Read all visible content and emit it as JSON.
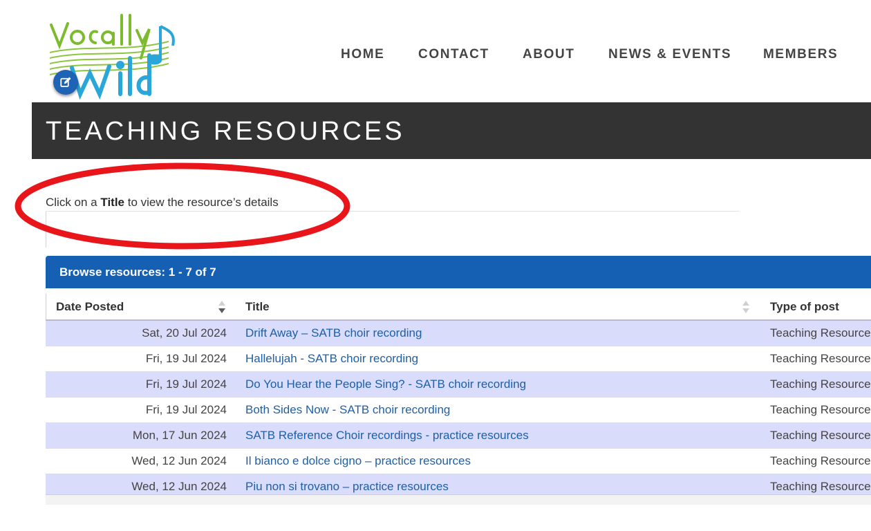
{
  "header": {
    "logo_text": "Vocally Wild",
    "nav": [
      "HOME",
      "CONTACT",
      "ABOUT",
      "NEWS & EVENTS",
      "MEMBERS"
    ]
  },
  "banner": {
    "title": "TEACHING RESOURCES"
  },
  "instruction": {
    "prefix": "Click on a ",
    "bold": "Title",
    "suffix": " to view the resource’s details"
  },
  "panel": {
    "heading": "Browse resources: 1 - 7 of 7"
  },
  "table": {
    "columns": [
      "Date Posted",
      "Title",
      "Type of post"
    ],
    "rows": [
      {
        "date": "Sat, 20 Jul 2024",
        "title": "Drift Away – SATB choir recording",
        "type": "Teaching Resource"
      },
      {
        "date": "Fri, 19 Jul 2024",
        "title": "Hallelujah - SATB choir recording",
        "type": "Teaching Resource"
      },
      {
        "date": "Fri, 19 Jul 2024",
        "title": "Do You Hear the People Sing? - SATB choir recording",
        "type": "Teaching Resource"
      },
      {
        "date": "Fri, 19 Jul 2024",
        "title": "Both Sides Now - SATB choir recording",
        "type": "Teaching Resource"
      },
      {
        "date": "Mon, 17 Jun 2024",
        "title": "SATB Reference Choir recordings - practice resources",
        "type": "Teaching Resource"
      },
      {
        "date": "Wed, 12 Jun 2024",
        "title": "Il bianco e dolce cigno – practice resources",
        "type": "Teaching Resource"
      },
      {
        "date": "Wed, 12 Jun 2024",
        "title": "Piu non si trovano – practice resources",
        "type": "Teaching Resource"
      }
    ]
  },
  "colors": {
    "banner_bg": "#333333",
    "panel_blue": "#1560b3",
    "row_stripe": "#dadcfc",
    "link": "#1d5fa8",
    "annotation_red": "#e8161b"
  }
}
